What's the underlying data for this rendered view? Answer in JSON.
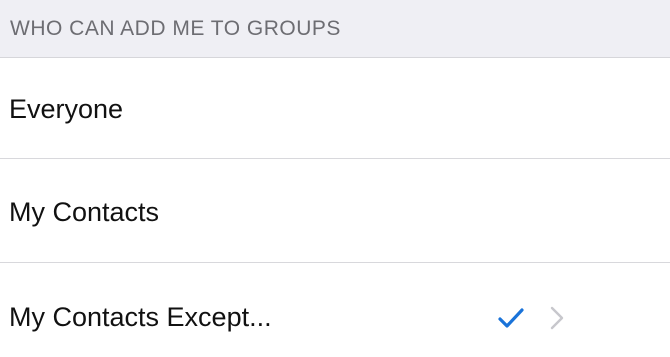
{
  "section": {
    "header": "WHO CAN ADD ME TO GROUPS"
  },
  "options": [
    {
      "label": "Everyone",
      "selected": false
    },
    {
      "label": "My Contacts",
      "selected": false
    },
    {
      "label": "My Contacts Except...",
      "selected": true
    }
  ],
  "icons": {
    "selected_indicator": "checkmark-icon",
    "disclosure": "chevron-right-icon"
  },
  "colors": {
    "accent": "#1a73d9",
    "header_background": "#efeff4",
    "header_text": "#6d6d72",
    "chevron": "#c7c7cc"
  }
}
